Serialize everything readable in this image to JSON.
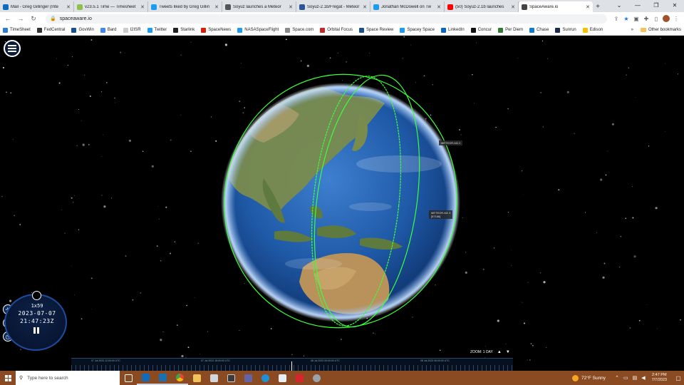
{
  "browser": {
    "tabs": [
      {
        "title": "Mail - Greg Gillinger (Inte",
        "color": "#0f6cbd",
        "active": false
      },
      {
        "title": "v23.5.1 Time — Timesheet",
        "color": "#8bc34a",
        "active": false
      },
      {
        "title": "Tweets liked by Greg Gillin",
        "color": "#1d9bf0",
        "active": false
      },
      {
        "title": "Soyuz launches a Meteor",
        "color": "#555555",
        "active": false
      },
      {
        "title": "Soyuz-2.1b/Fregat - Meteor",
        "color": "#2b5797",
        "active": false
      },
      {
        "title": "Jonathan McDowell on Tw",
        "color": "#1d9bf0",
        "active": false
      },
      {
        "title": "(50) Soyuz-2.1b launches",
        "color": "#ff0000",
        "active": false
      },
      {
        "title": "SpaceAware.io",
        "color": "#444444",
        "active": true
      }
    ],
    "new_tab_label": "+",
    "url": "spaceaware.io",
    "bookmarks": [
      {
        "label": "TimeSheet",
        "color": "#2b7cd3"
      },
      {
        "label": "FedCentral",
        "color": "#333333"
      },
      {
        "label": "GovWin",
        "color": "#1b4f91"
      },
      {
        "label": "Bard",
        "color": "#4285f4"
      },
      {
        "label": "I2ISR",
        "color": "#cccccc"
      },
      {
        "label": "Twitter",
        "color": "#1d9bf0"
      },
      {
        "label": "Starlink",
        "color": "#222222"
      },
      {
        "label": "SpaceNews",
        "color": "#d81e05"
      },
      {
        "label": "NASASpaceFlight",
        "color": "#1d9bf0"
      },
      {
        "label": "Space.com",
        "color": "#8a8a8a"
      },
      {
        "label": "Orbital Focus",
        "color": "#c62828"
      },
      {
        "label": "Space Review",
        "color": "#1b4f91"
      },
      {
        "label": "Spacey Space",
        "color": "#1d9bf0"
      },
      {
        "label": "LinkedIn",
        "color": "#0a66c2"
      },
      {
        "label": "Concur",
        "color": "#111111"
      },
      {
        "label": "Per Diem",
        "color": "#2e7d32"
      },
      {
        "label": "Chase",
        "color": "#117aca"
      },
      {
        "label": "Sunrun",
        "color": "#1a2b4c"
      },
      {
        "label": "Edison",
        "color": "#f5c400"
      }
    ],
    "other_bookmarks": "Other bookmarks"
  },
  "app": {
    "satellite_labels": [
      {
        "line1": "METEOR-M2.2",
        "line2": ""
      },
      {
        "line1": "METEOR-M2 3",
        "line2": "[57166]"
      }
    ],
    "clock": {
      "speed": "1x59",
      "date": "2023-07-07",
      "time": "21:47:23Z"
    },
    "timeline": {
      "labels": [
        "07 Jul 2023 12:00:00 UTC",
        "07 Jul 2023 18:00:00 UTC",
        "08 Jul 2023 00:00:00 UTC",
        "08 Jul 2023 06:00:00 UTC"
      ],
      "zoom_label": "ZOOM: 1 DAY"
    },
    "colors": {
      "orbit": "#3cff3c",
      "ocean": "#1f5aa8"
    }
  },
  "taskbar": {
    "search_placeholder": "Type here to search",
    "weather": "72°F  Sunny",
    "time": "2:47 PM",
    "date": "7/7/2023"
  }
}
